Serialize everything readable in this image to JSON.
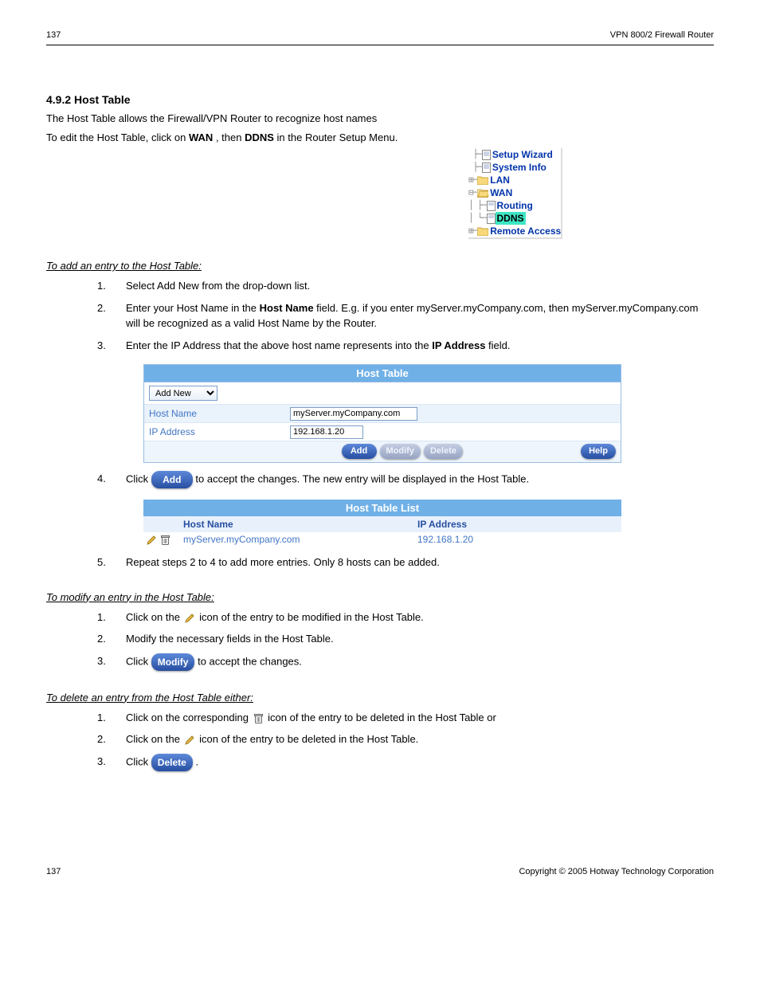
{
  "page_header": {
    "product": "VPN 800/2 Firewall Router",
    "page_no": "137"
  },
  "section": {
    "number": "4.9.2",
    "title": "Host Table",
    "para1": "The Host Table allows the Firewall/VPN Router to recognize host names",
    "para2_prefix": "To edit the Host Table, click on ",
    "para2_bold1": "WAN",
    "para2_mid": ", then ",
    "para2_bold2": "DDNS",
    "para2_suffix": " in the Router Setup Menu."
  },
  "nav_tree": {
    "items": [
      {
        "label": "Setup Wizard",
        "indent": 1,
        "icon": "page",
        "name": "nav-setup-wizard"
      },
      {
        "label": "System Info",
        "indent": 1,
        "icon": "page",
        "name": "nav-system-info"
      },
      {
        "label": "LAN",
        "indent": 0,
        "icon": "folder",
        "expand": true,
        "name": "nav-lan"
      },
      {
        "label": "WAN",
        "indent": 0,
        "icon": "folder",
        "expand": true,
        "name": "nav-wan"
      },
      {
        "label": "Routing",
        "indent": 1,
        "icon": "page",
        "name": "nav-routing"
      },
      {
        "label": "DDNS",
        "indent": 1,
        "icon": "page",
        "highlight": true,
        "name": "nav-ddns"
      },
      {
        "label": "Remote Access",
        "indent": 0,
        "icon": "folder",
        "expand": true,
        "name": "nav-remote-access"
      }
    ]
  },
  "add_entry": {
    "heading": "To add an entry to the Host Table:",
    "step1": "Select Add New from the drop-down list.",
    "step2_part1": "Enter your Host Name in the ",
    "step2_bold": "Host Name",
    "step2_part2": " field. E.g. if you enter myServer.myCompany.com, then myServer.myCompany.com will be recognized as a valid Host Name by the Router.",
    "step3_part1": "Enter the IP Address that the above host name represents into the ",
    "step3_bold": "IP Address",
    "step3_part2": " field.",
    "step4": "Click         to accept the changes. The new entry will be displayed in the Host Table.",
    "step5": "Repeat steps 2 to 4 to add more entries. Only 8 hosts can be added."
  },
  "host_table_fig": {
    "title": "Host Table",
    "select_value": "Add New",
    "row_hostname_label": "Host Name",
    "row_hostname_value": "myServer.myCompany.com",
    "row_ip_label": "IP Address",
    "row_ip_value": "192.168.1.20",
    "btn_add": "Add",
    "btn_modify": "Modify",
    "btn_delete": "Delete",
    "btn_help": "Help"
  },
  "host_list_fig": {
    "title": "Host Table List",
    "col_hostname": "Host Name",
    "col_ip": "IP Address",
    "rows": [
      {
        "hostname": "myServer.myCompany.com",
        "ip": "192.168.1.20"
      }
    ]
  },
  "modify_entry": {
    "heading": "To modify an entry in the Host Table:",
    "step1_part1": "Click on the   ",
    "step1_part2": "icon of the entry to be modified in the Host Table.",
    "step2": "Modify the necessary fields in the Host Table.",
    "step3_prefix": "Click ",
    "step3_suffix": " to accept the changes."
  },
  "delete_entry": {
    "heading": "To delete an entry from the Host Table either:",
    "step1_part1": "Click on the corresponding   ",
    "step1_part2": "icon of the entry to be deleted in the Host Table or",
    "step2_part1": "Click on the   ",
    "step2_part2": "icon of the entry to be deleted in the Host Table.",
    "step3_prefix": "Click ",
    "step3_suffix": "."
  },
  "buttons": {
    "add": "Add",
    "modify": "Modify",
    "delete": "Delete"
  },
  "footer": {
    "left": "137",
    "right": "Copyright © 2005 Hotway Technology Corporation"
  }
}
